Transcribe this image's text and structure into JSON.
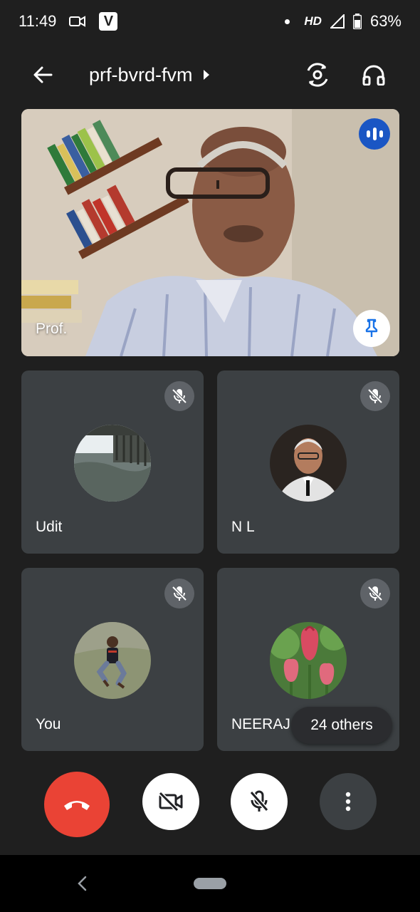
{
  "status_bar": {
    "time": "11:49",
    "video_icon": "video-camera-icon",
    "app_badge": "V",
    "network_label": "HD",
    "battery": "63%"
  },
  "header": {
    "meeting_code": "prf-bvrd-fvm",
    "back_icon": "arrow-back-icon",
    "switch_camera_icon": "switch-camera-icon",
    "audio_icon": "headphones-icon"
  },
  "main_speaker": {
    "name": "Prof.",
    "speaking_icon": "speaking-indicator-icon",
    "pin_icon": "pin-icon"
  },
  "participants": [
    {
      "name": "Udit",
      "muted": true
    },
    {
      "name": "N L",
      "muted": true
    },
    {
      "name": "You",
      "muted": true
    },
    {
      "name": "NEERAJ",
      "muted": true
    }
  ],
  "others_chip": "24 others",
  "controls": {
    "end_call_icon": "phone-hangup-icon",
    "camera_icon": "camera-off-icon",
    "mic_icon": "mic-off-icon",
    "more_icon": "more-vert-icon",
    "colors": {
      "end_call": "#ea4335",
      "active": "#ffffff",
      "neutral": "#3c4043"
    }
  },
  "nav": {
    "back_icon": "nav-back-icon",
    "home_icon": "home-pill-icon"
  }
}
